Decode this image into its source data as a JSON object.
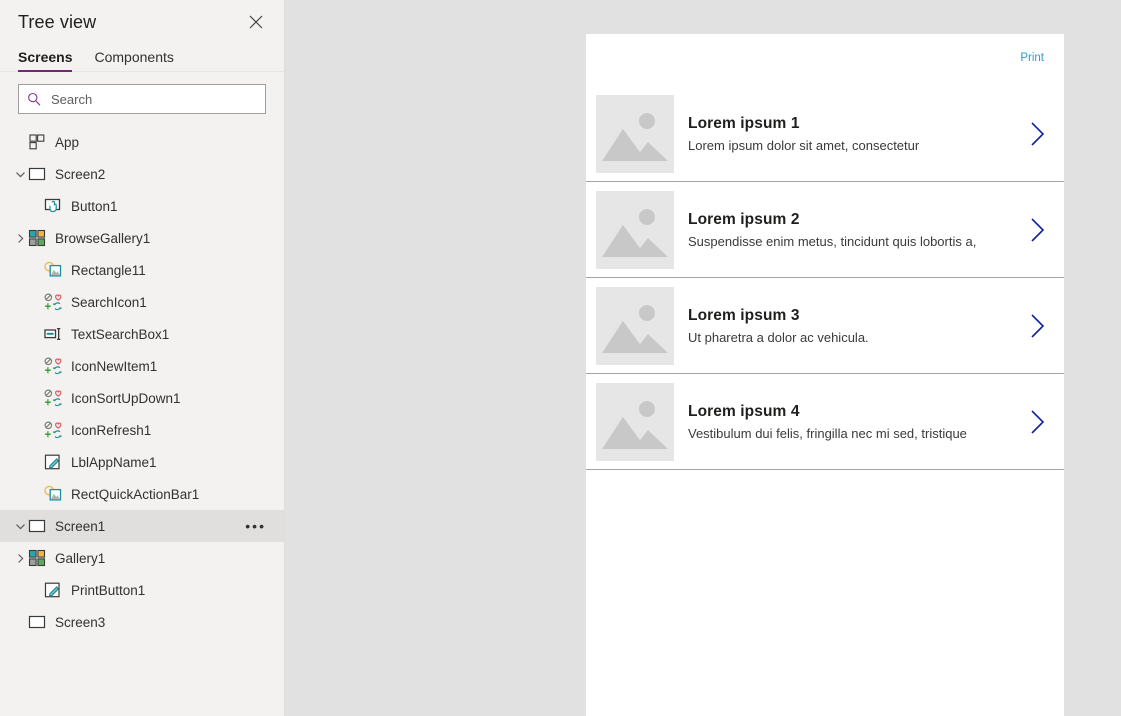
{
  "panel": {
    "title": "Tree view",
    "close_icon": "close-icon",
    "tabs": [
      {
        "label": "Screens",
        "active": true
      },
      {
        "label": "Components",
        "active": false
      }
    ],
    "search": {
      "placeholder": "Search",
      "value": "",
      "icon": "search-icon"
    }
  },
  "tree": [
    {
      "label": "App",
      "icon": "app-icon",
      "indent": "lvl1",
      "chevron": "",
      "selected": false,
      "menu": false
    },
    {
      "label": "Screen2",
      "icon": "screen-icon",
      "indent": "lvl0",
      "chevron": "expanded",
      "selected": false,
      "menu": false
    },
    {
      "label": "Button1",
      "icon": "button-icon",
      "indent": "lvl2",
      "chevron": "",
      "selected": false,
      "menu": false
    },
    {
      "label": "BrowseGallery1",
      "icon": "gallery-icon",
      "indent": "lvl1",
      "chevron": "collapsed",
      "selected": false,
      "menu": false
    },
    {
      "label": "Rectangle11",
      "icon": "rectangle-icon",
      "indent": "lvl2",
      "chevron": "",
      "selected": false,
      "menu": false
    },
    {
      "label": "SearchIcon1",
      "icon": "icon-control-icon",
      "indent": "lvl2",
      "chevron": "",
      "selected": false,
      "menu": false
    },
    {
      "label": "TextSearchBox1",
      "icon": "textbox-icon",
      "indent": "lvl2",
      "chevron": "",
      "selected": false,
      "menu": false
    },
    {
      "label": "IconNewItem1",
      "icon": "icon-control-icon",
      "indent": "lvl2",
      "chevron": "",
      "selected": false,
      "menu": false
    },
    {
      "label": "IconSortUpDown1",
      "icon": "icon-control-icon",
      "indent": "lvl2",
      "chevron": "",
      "selected": false,
      "menu": false
    },
    {
      "label": "IconRefresh1",
      "icon": "icon-control-icon",
      "indent": "lvl2",
      "chevron": "",
      "selected": false,
      "menu": false
    },
    {
      "label": "LblAppName1",
      "icon": "label-icon",
      "indent": "lvl2",
      "chevron": "",
      "selected": false,
      "menu": false
    },
    {
      "label": "RectQuickActionBar1",
      "icon": "rectangle-icon",
      "indent": "lvl2",
      "chevron": "",
      "selected": false,
      "menu": false
    },
    {
      "label": "Screen1",
      "icon": "screen-icon",
      "indent": "lvl0",
      "chevron": "expanded",
      "selected": true,
      "menu": true,
      "menu_label": "•••"
    },
    {
      "label": "Gallery1",
      "icon": "gallery-icon",
      "indent": "lvl1",
      "chevron": "collapsed",
      "selected": false,
      "menu": false
    },
    {
      "label": "PrintButton1",
      "icon": "label-icon",
      "indent": "lvl2",
      "chevron": "",
      "selected": false,
      "menu": false
    },
    {
      "label": "Screen3",
      "icon": "screen-icon",
      "indent": "lvl1",
      "chevron": "",
      "selected": false,
      "menu": false
    }
  ],
  "canvas": {
    "print_label": "Print",
    "chevron_icon": "chevron-right-icon",
    "thumbnail_icon": "image-placeholder-icon",
    "items": [
      {
        "title": "Lorem ipsum 1",
        "subtitle": "Lorem ipsum dolor sit amet, consectetur"
      },
      {
        "title": "Lorem ipsum 2",
        "subtitle": "Suspendisse enim metus, tincidunt quis lobortis a,"
      },
      {
        "title": "Lorem ipsum 3",
        "subtitle": "Ut pharetra a dolor ac vehicula."
      },
      {
        "title": "Lorem ipsum 4",
        "subtitle": "Vestibulum dui felis, fringilla nec mi sed, tristique"
      }
    ]
  },
  "colors": {
    "accent": "#742774",
    "panel_bg": "#f3f2f1",
    "canvas_bg": "#e1e1e1",
    "print_link": "#2e9bd6",
    "item_divider": "#9aa4c4",
    "chevron": "#10239e"
  }
}
